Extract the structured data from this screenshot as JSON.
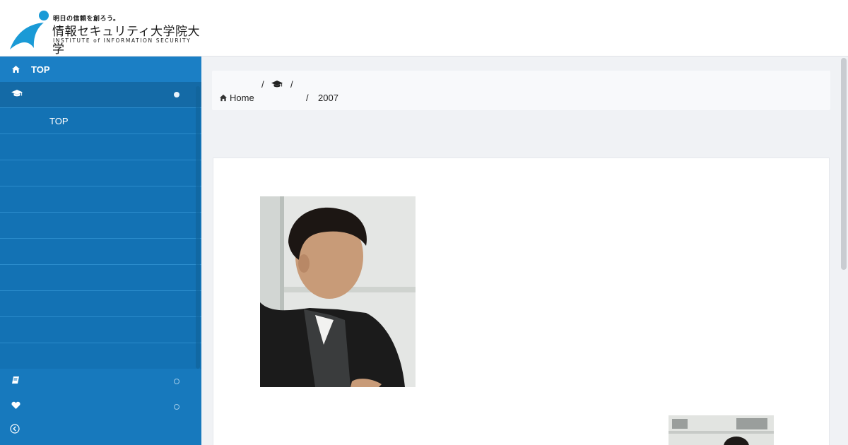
{
  "header": {
    "logo_tagline": "明日の信頼を創ろう。",
    "logo_name": "情報セキュリティ大学院大学",
    "logo_sub": "INSTITUTE of INFORMATION SECURITY"
  },
  "sidebar": {
    "top_label": "TOP",
    "active_label": "",
    "sub_items": [
      "TOP",
      "",
      "",
      "",
      "",
      "",
      "",
      "",
      "",
      ""
    ],
    "bottom_items": [
      {
        "icon": "book-icon",
        "label": ""
      },
      {
        "icon": "heart-icon",
        "label": ""
      }
    ],
    "collapse_icon": "chevron-left-circle-icon"
  },
  "breadcrumb": {
    "sep1": "/",
    "sep2": "/",
    "home_label": "Home",
    "sep3": "/",
    "current": "2007"
  },
  "colors": {
    "sidebar": "#1779bd",
    "sidebar_active": "#146aa6",
    "logo_blue": "#1a9ad6",
    "page_bg": "#f0f2f5"
  }
}
